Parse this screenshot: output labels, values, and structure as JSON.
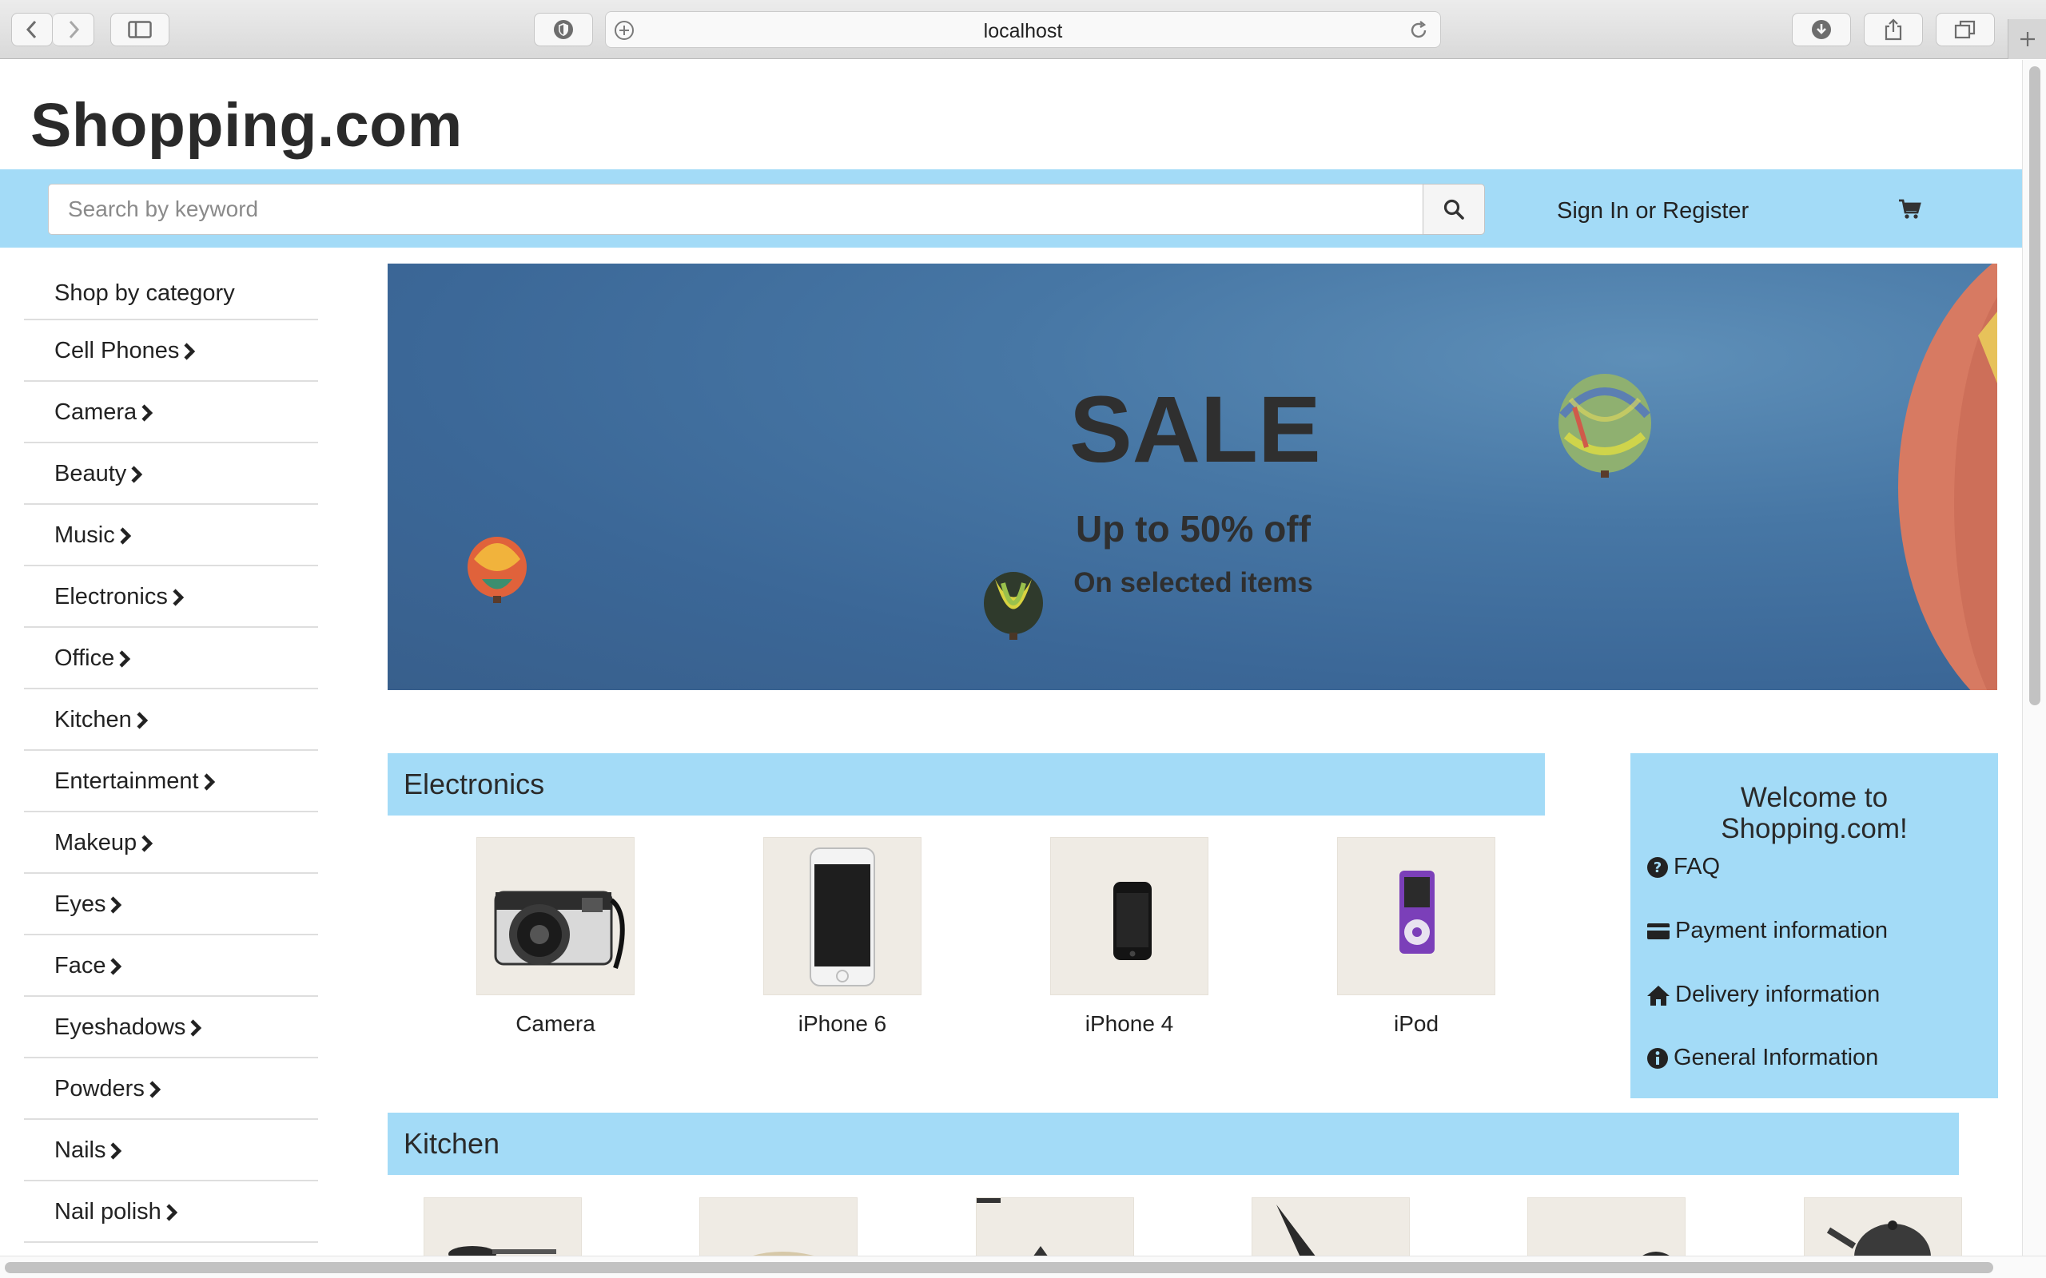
{
  "browser": {
    "url": "localhost"
  },
  "site": {
    "logo": "Shopping.com"
  },
  "header": {
    "search_placeholder": "Search by keyword",
    "search_value": "",
    "signin_label": "Sign In or Register"
  },
  "sidebar": {
    "heading": "Shop by category",
    "items": [
      {
        "label": "Cell Phones"
      },
      {
        "label": "Camera"
      },
      {
        "label": "Beauty"
      },
      {
        "label": "Music"
      },
      {
        "label": "Electronics"
      },
      {
        "label": "Office"
      },
      {
        "label": "Kitchen"
      },
      {
        "label": "Entertainment"
      },
      {
        "label": "Makeup"
      },
      {
        "label": "Eyes"
      },
      {
        "label": "Face"
      },
      {
        "label": "Eyeshadows"
      },
      {
        "label": "Powders"
      },
      {
        "label": "Nails"
      },
      {
        "label": "Nail polish"
      }
    ]
  },
  "banner": {
    "headline": "SALE",
    "offer": "Up to 50% off",
    "subtext": "On selected items"
  },
  "electronics": {
    "title": "Electronics",
    "products": [
      {
        "label": "Camera",
        "icon": "camera-image"
      },
      {
        "label": "iPhone 6",
        "icon": "iphone6-image"
      },
      {
        "label": "iPhone 4",
        "icon": "iphone4-image"
      },
      {
        "label": "iPod",
        "icon": "ipod-image"
      }
    ]
  },
  "welcome": {
    "title_line1": "Welcome to",
    "title_line2": "Shopping.com!",
    "links": [
      {
        "label": "FAQ",
        "icon": "question-circle-icon"
      },
      {
        "label": "Payment information",
        "icon": "credit-card-icon"
      },
      {
        "label": "Delivery information",
        "icon": "home-icon"
      },
      {
        "label": "General Information",
        "icon": "info-circle-icon"
      }
    ]
  },
  "kitchen": {
    "title": "Kitchen"
  },
  "colors": {
    "accent": "#a3dbf7",
    "banner_sky": "#3b6797",
    "text": "#222222"
  }
}
